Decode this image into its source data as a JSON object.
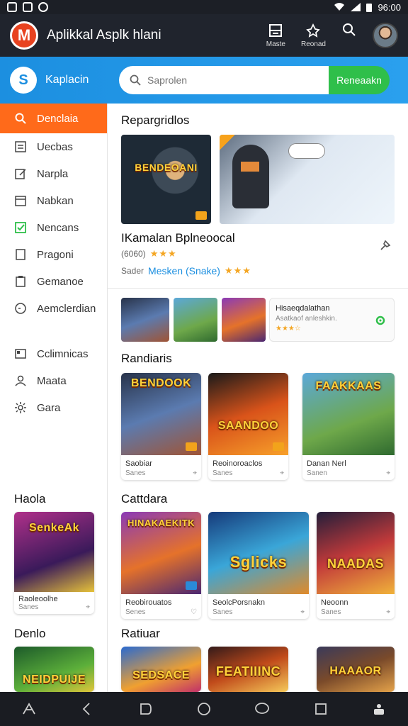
{
  "status_bar": {
    "time": "96:00"
  },
  "header": {
    "logo_letter": "M",
    "title": "Aplikkal Asplk hlani",
    "actions": [
      {
        "label": "Maste",
        "icon": "grid-icon"
      },
      {
        "label": "Reonad",
        "icon": "bell-icon"
      }
    ]
  },
  "search": {
    "brand_label": "Kaplacin",
    "placeholder": "Saprolen",
    "button_label": "Reneaakn"
  },
  "sidebar": {
    "items": [
      {
        "label": "Denclaia",
        "icon": "search-icon",
        "active": true
      },
      {
        "label": "Uecbas",
        "icon": "list-icon"
      },
      {
        "label": "Narpla",
        "icon": "edit-icon"
      },
      {
        "label": "Nabkan",
        "icon": "calendar-icon"
      },
      {
        "label": "Nencans",
        "icon": "check-icon"
      },
      {
        "label": "Pragoni",
        "icon": "document-icon"
      },
      {
        "label": "Gemanoe",
        "icon": "clipboard-icon"
      },
      {
        "label": "Aemclerdian",
        "icon": "clock-icon"
      },
      {
        "label": "Cclimnicas",
        "icon": "folder-icon"
      },
      {
        "label": "Maata",
        "icon": "user-icon"
      },
      {
        "label": "Gara",
        "icon": "settings-icon"
      }
    ],
    "section1": {
      "title": "Haola",
      "card": {
        "art_text": "SenkeAk",
        "title": "Raoleoolhe",
        "sub": "Sanes"
      }
    },
    "section2": {
      "title": "Denlo",
      "card": {
        "art_text": "NEIDPUIJE"
      }
    }
  },
  "main": {
    "section_featured": {
      "title": "Repargridlos",
      "hero_left_text": "BENDEOANI",
      "hero_title": "IKamalan Bplneoocal",
      "hero_rating_prefix": "(6060)",
      "hero_stars": "★★★",
      "hero_sub_prefix": "Sader",
      "hero_sub_link": "Mesken (Snake)",
      "hero_sub_stars": "★★★"
    },
    "promo": {
      "line1": "Hisaeqdalathan",
      "line2": "Asatkaof anleshkin.",
      "line3": "★★★☆"
    },
    "section_random": {
      "title": "Randiaris",
      "cards": [
        {
          "art_text": "BENDOOK",
          "title": "Saobiar",
          "sub": "Sanes"
        },
        {
          "art_text": "SAANDOO",
          "title": "Reoinoroaclos",
          "sub": "Sanes"
        },
        {
          "art_text": "FAAKKAAS",
          "title": "Danan Nerl",
          "sub": "Sanen"
        }
      ]
    },
    "section_cattdara": {
      "title": "Cattdara",
      "cards": [
        {
          "art_text": "HINAKAEKITK",
          "title": "Reobirouatos",
          "sub": "Senes"
        },
        {
          "art_text": "Sglicks",
          "title": "SeolcPorsnakn",
          "sub": "Sanes"
        },
        {
          "art_text": "NAADAS",
          "title": "Neoonn",
          "sub": "Sanes"
        }
      ]
    },
    "section_ratiuar": {
      "title": "Ratiuar",
      "cards": [
        {
          "art_text": "SEDSACE"
        },
        {
          "art_text": "FEATIIINC"
        },
        {
          "art_text": "HAAAOR"
        }
      ]
    }
  }
}
